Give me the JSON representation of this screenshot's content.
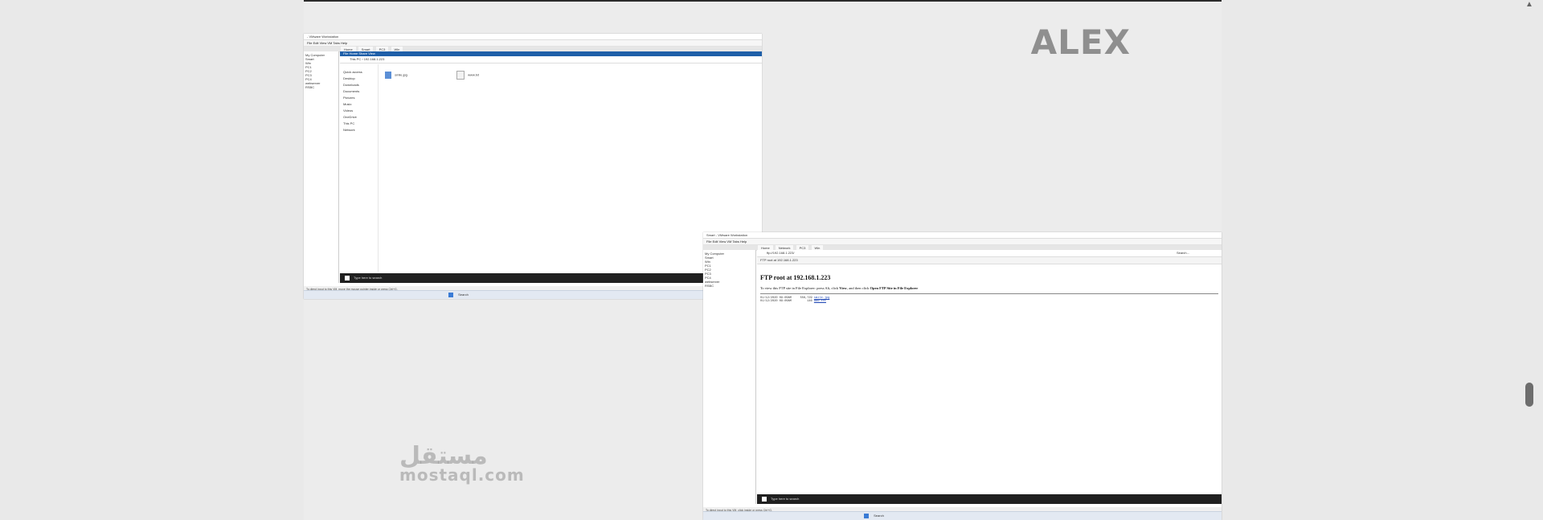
{
  "brand": {
    "name": "ALEX"
  },
  "watermark": {
    "arabic": "مستقل",
    "latin": "mostaql.com"
  },
  "screenshot1": {
    "title": "- VMware Workstation",
    "menu": [
      "File",
      "Edit",
      "View",
      "VM",
      "Tabs",
      "Help"
    ],
    "tabs": [
      "Home",
      "Smart",
      "PC3",
      "Win"
    ],
    "library": [
      "My Computer",
      "Smart",
      "Win",
      "PC1",
      "PC2",
      "PC3",
      "PC4",
      "webserver",
      "RSBC"
    ],
    "ribbon": [
      "File",
      "Home",
      "Share",
      "View"
    ],
    "address": "This PC › 192.168.1.223",
    "nav": [
      "Quick access",
      "Desktop",
      "Downloads",
      "Documents",
      "Pictures",
      "Music",
      "Videos",
      "OneDrive",
      "This PC",
      "Network"
    ],
    "files": [
      "smile.jpg",
      "www.txt"
    ],
    "guest_search": "Type here to search",
    "host_status": "To direct input to this VM, move the mouse pointer inside or press Ctrl+G.",
    "host_search": "Search"
  },
  "screenshot2": {
    "title": "Smart - VMware Workstation",
    "menu": [
      "File",
      "Edit",
      "View",
      "VM",
      "Tabs",
      "Help"
    ],
    "tabs": [
      "Home",
      "Network",
      "PC3",
      "Win"
    ],
    "library": [
      "My Computer",
      "Smart",
      "Win",
      "PC1",
      "PC2",
      "PC3",
      "PC4",
      "webserver",
      "RSBC"
    ],
    "address": "ftp://192.168.1.223/",
    "search_placeholder": "Search...",
    "browser_tab": "FTP root at 192.168.1.223",
    "ftp_title": "FTP root at 192.168.1.223",
    "ftp_text_before": "To view this FTP site in File Explorer: press Alt, click",
    "ftp_view": "View",
    "ftp_text_mid": ", and then click",
    "ftp_open": "Open FTP Site in File Explorer",
    "ftp_entries": [
      {
        "meta": "01/12/2020 09:00AM     556,729",
        "name": "smile.jpg"
      },
      {
        "meta": "01/12/2020 09:00AM         146",
        "name": "www.txt"
      }
    ],
    "guest_search": "Type here to search",
    "host_status": "To direct input to this VM, click inside or press Ctrl+G.",
    "host_search": "Search"
  }
}
